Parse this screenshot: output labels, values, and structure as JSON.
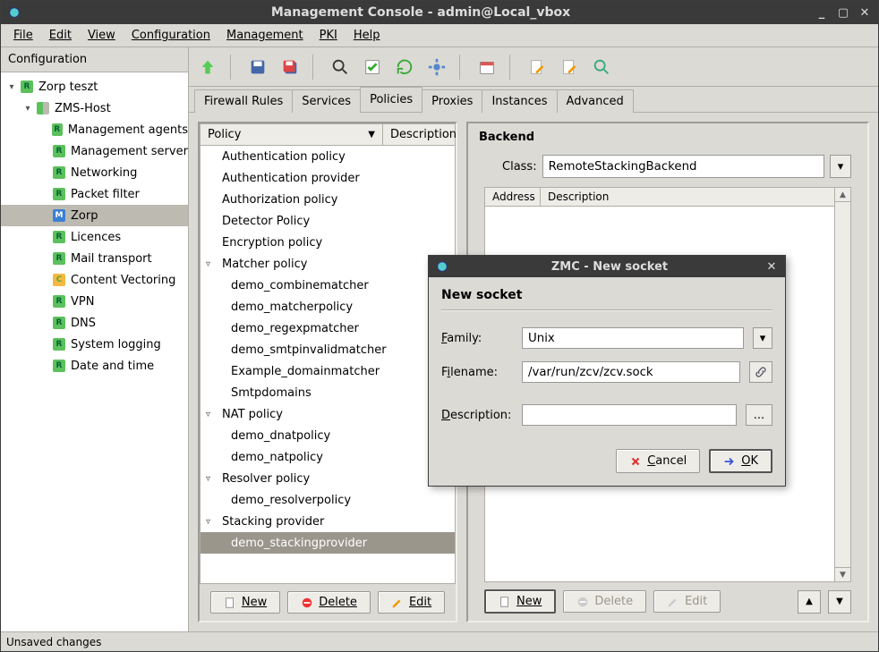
{
  "window": {
    "title": "Management Console - admin@Local_vbox"
  },
  "menubar": [
    "File",
    "Edit",
    "View",
    "Configuration",
    "Management",
    "PKI",
    "Help"
  ],
  "sidebar": {
    "title": "Configuration",
    "items": [
      {
        "label": "Zorp teszt",
        "indent": 0,
        "badge": "green",
        "twisty": "▾"
      },
      {
        "label": "ZMS-Host",
        "indent": 1,
        "badge": "multi",
        "twisty": "▾"
      },
      {
        "label": "Management agents",
        "indent": 2,
        "badge": "green"
      },
      {
        "label": "Management server",
        "indent": 2,
        "badge": "green"
      },
      {
        "label": "Networking",
        "indent": 2,
        "badge": "green"
      },
      {
        "label": "Packet filter",
        "indent": 2,
        "badge": "green"
      },
      {
        "label": "Zorp",
        "indent": 2,
        "badge": "blue",
        "selected": true
      },
      {
        "label": "Licences",
        "indent": 2,
        "badge": "green"
      },
      {
        "label": "Mail transport",
        "indent": 2,
        "badge": "green"
      },
      {
        "label": "Content Vectoring",
        "indent": 2,
        "badge": "orange"
      },
      {
        "label": "VPN",
        "indent": 2,
        "badge": "green"
      },
      {
        "label": "DNS",
        "indent": 2,
        "badge": "green"
      },
      {
        "label": "System logging",
        "indent": 2,
        "badge": "green"
      },
      {
        "label": "Date and time",
        "indent": 2,
        "badge": "green"
      }
    ]
  },
  "tabs": [
    "Firewall Rules",
    "Services",
    "Policies",
    "Proxies",
    "Instances",
    "Advanced"
  ],
  "active_tab": 2,
  "policy_panel": {
    "col1": "Policy",
    "col2": "Description",
    "items": [
      {
        "label": "Authentication policy",
        "sub": false
      },
      {
        "label": "Authentication provider",
        "sub": false
      },
      {
        "label": "Authorization policy",
        "sub": false
      },
      {
        "label": "Detector Policy",
        "sub": false
      },
      {
        "label": "Encryption policy",
        "sub": false
      },
      {
        "label": "Matcher policy",
        "sub": false,
        "twisty": "▿"
      },
      {
        "label": "demo_combinematcher",
        "sub": true
      },
      {
        "label": "demo_matcherpolicy",
        "sub": true
      },
      {
        "label": "demo_regexpmatcher",
        "sub": true
      },
      {
        "label": "demo_smtpinvalidmatcher",
        "sub": true
      },
      {
        "label": "Example_domainmatcher",
        "sub": true
      },
      {
        "label": "Smtpdomains",
        "sub": true
      },
      {
        "label": "NAT policy",
        "sub": false,
        "twisty": "▿"
      },
      {
        "label": "demo_dnatpolicy",
        "sub": true
      },
      {
        "label": "demo_natpolicy",
        "sub": true
      },
      {
        "label": "Resolver policy",
        "sub": false,
        "twisty": "▿"
      },
      {
        "label": "demo_resolverpolicy",
        "sub": true
      },
      {
        "label": "Stacking provider",
        "sub": false,
        "twisty": "▿"
      },
      {
        "label": "demo_stackingprovider",
        "sub": true,
        "selected": true
      }
    ],
    "buttons": {
      "new": "New",
      "delete": "Delete",
      "edit": "Edit"
    }
  },
  "backend": {
    "title": "Backend",
    "class_label": "Class:",
    "class_value": "RemoteStackingBackend",
    "cols": [
      "Address",
      "Description"
    ],
    "buttons": {
      "new": "New",
      "delete": "Delete",
      "edit": "Edit"
    }
  },
  "dialog": {
    "title": "ZMC - New socket",
    "heading": "New socket",
    "family_label": "Family:",
    "family_value": "Unix",
    "filename_label": "Filename:",
    "filename_value": "/var/run/zcv/zcv.sock",
    "description_label": "Description:",
    "description_value": "",
    "cancel": "Cancel",
    "ok": "OK"
  },
  "statusbar": "Unsaved changes"
}
